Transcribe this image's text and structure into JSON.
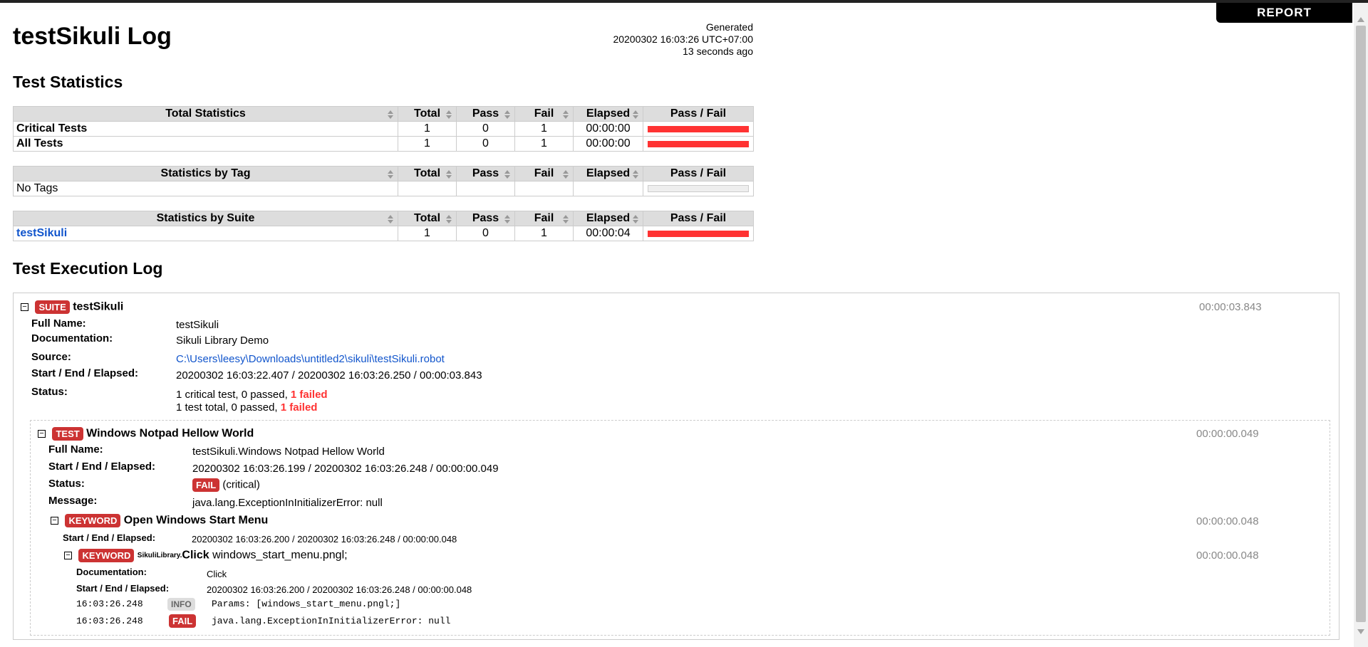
{
  "report_label": "REPORT",
  "title": "testSikuli Log",
  "generated": {
    "label": "Generated",
    "datetime": "20200302 16:03:26 UTC+07:00",
    "ago": "13 seconds ago"
  },
  "stats_heading": "Test Statistics",
  "columns": [
    "Total",
    "Pass",
    "Fail",
    "Elapsed",
    "Pass / Fail"
  ],
  "total_stats": {
    "header": "Total Statistics",
    "rows": [
      {
        "name": "Critical Tests",
        "total": "1",
        "pass": "0",
        "fail": "1",
        "elapsed": "00:00:00",
        "fail_fraction": 1
      },
      {
        "name": "All Tests",
        "total": "1",
        "pass": "0",
        "fail": "1",
        "elapsed": "00:00:00",
        "fail_fraction": 1
      }
    ]
  },
  "tag_stats": {
    "header": "Statistics by Tag",
    "rows": [
      {
        "name": "No Tags",
        "total": "",
        "pass": "",
        "fail": "",
        "elapsed": ""
      }
    ]
  },
  "suite_stats": {
    "header": "Statistics by Suite",
    "rows": [
      {
        "name": "testSikuli",
        "total": "1",
        "pass": "0",
        "fail": "1",
        "elapsed": "00:00:04",
        "fail_fraction": 1
      }
    ]
  },
  "log_heading": "Test Execution Log",
  "suite": {
    "badge": "SUITE",
    "name": "testSikuli",
    "elapsed": "00:00:03.843",
    "full_name_label": "Full Name:",
    "full_name": "testSikuli",
    "doc_label": "Documentation:",
    "doc": "Sikuli Library Demo",
    "source_label": "Source:",
    "source": "C:\\Users\\leesy\\Downloads\\untitled2\\sikuli\\testSikuli.robot",
    "times_label": "Start / End / Elapsed:",
    "times": "20200302 16:03:22.407 / 20200302 16:03:26.250 / 00:00:03.843",
    "status_label": "Status:",
    "status_line1_prefix": "1 critical test, 0 passed, ",
    "status_line1_fail": "1 failed",
    "status_line2_prefix": "1 test total, 0 passed, ",
    "status_line2_fail": "1 failed"
  },
  "test": {
    "badge": "TEST",
    "name": "Windows Notpad Hellow World",
    "elapsed": "00:00:00.049",
    "full_name_label": "Full Name:",
    "full_name": "testSikuli.Windows Notpad Hellow World",
    "times_label": "Start / End / Elapsed:",
    "times": "20200302 16:03:26.199 / 20200302 16:03:26.248 / 00:00:00.049",
    "status_label": "Status:",
    "status_badge": "FAIL",
    "status_suffix": "(critical)",
    "message_label": "Message:",
    "message": "java.lang.ExceptionInInitializerError: null"
  },
  "keyword1": {
    "badge": "KEYWORD",
    "name": "Open Windows Start Menu",
    "elapsed": "00:00:00.048",
    "times_label": "Start / End / Elapsed:",
    "times": "20200302 16:03:26.200 / 20200302 16:03:26.248 / 00:00:00.048"
  },
  "keyword2": {
    "badge": "KEYWORD",
    "lib": "SikuliLibrary.",
    "name": "Click",
    "args": "windows_start_menu.pngl;",
    "elapsed": "00:00:00.048",
    "doc_label": "Documentation:",
    "doc": "Click",
    "times_label": "Start / End / Elapsed:",
    "times": "20200302 16:03:26.200 / 20200302 16:03:26.248 / 00:00:00.048",
    "messages": [
      {
        "time": "16:03:26.248",
        "level": "INFO",
        "text": "Params: [windows_start_menu.pngl;]"
      },
      {
        "time": "16:03:26.248",
        "level": "FAIL",
        "text": "java.lang.ExceptionInInitializerError: null"
      }
    ]
  }
}
